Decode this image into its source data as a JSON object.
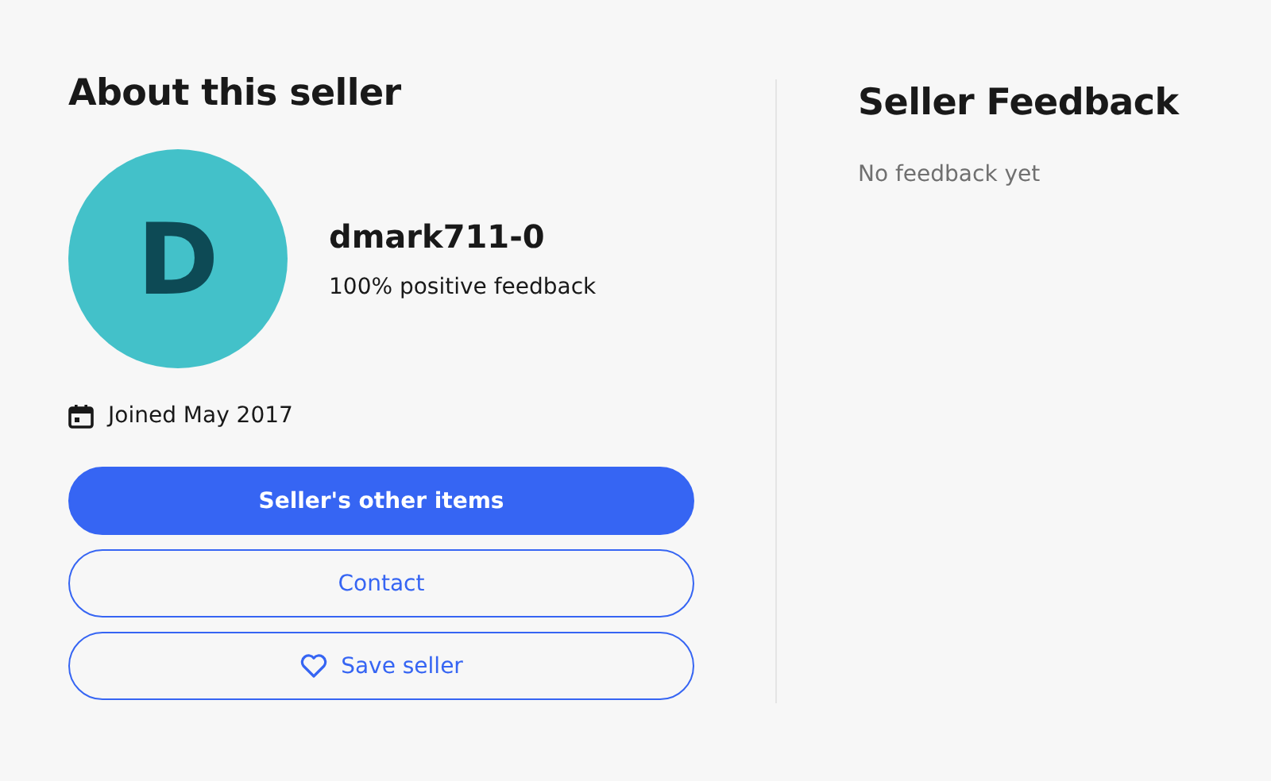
{
  "about": {
    "title": "About this seller",
    "avatar_letter": "D",
    "username": "dmark711-0",
    "feedback_score": "100% positive feedback",
    "joined": "Joined May 2017",
    "buttons": [
      {
        "label": "Seller's other items",
        "kind": "primary"
      },
      {
        "label": "Contact",
        "kind": "secondary"
      },
      {
        "label": "Save seller",
        "kind": "save"
      }
    ]
  },
  "feedback": {
    "title": "Seller Feedback",
    "message": "No feedback yet"
  }
}
